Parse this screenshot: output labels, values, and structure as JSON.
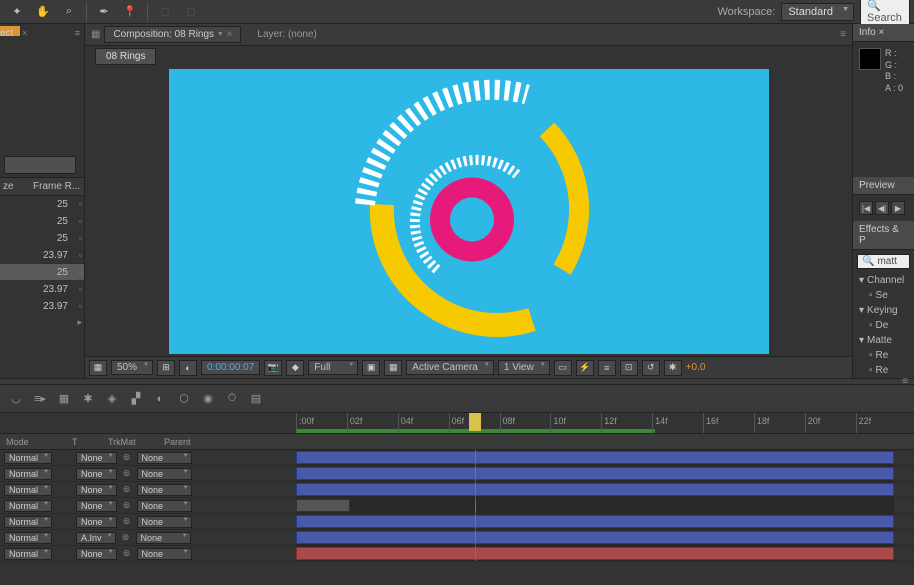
{
  "topbar": {
    "workspace_label": "Workspace:",
    "workspace_value": "Standard",
    "search_placeholder": "Search"
  },
  "left_panel": {
    "headers": [
      "ze",
      "Frame R..."
    ],
    "rows": [
      "25",
      "25",
      "25",
      "23.97",
      "25",
      "23.97",
      "23.97"
    ],
    "highlight_row": 4
  },
  "comp_panel": {
    "tab_label": "Composition: 08 Rings",
    "layer_label": "Layer: (none)",
    "sub_tab": "08 Rings"
  },
  "viewer_controls": {
    "zoom": "50%",
    "timecode": "0:00:00:07",
    "resolution": "Full",
    "camera": "Active Camera",
    "view": "1 View",
    "exposure": "+0.0"
  },
  "info_panel": {
    "title": "Info",
    "r": "R :",
    "g": "G :",
    "b": "B :",
    "a": "A : 0"
  },
  "preview_panel": {
    "title": "Preview"
  },
  "effects_panel": {
    "title": "Effects & P",
    "search": "matt",
    "cats": [
      "Channel",
      "Keying",
      "Matte"
    ],
    "items": [
      "Se",
      "De",
      "Re",
      "Re"
    ]
  },
  "timeline": {
    "head": {
      "mode": "Mode",
      "t": "T",
      "trkmat": "TrkMat",
      "parent": "Parent"
    },
    "ticks": [
      ":00f",
      "02f",
      "04f",
      "06f",
      "08f",
      "10f",
      "12f",
      "14f",
      "16f",
      "18f",
      "20f",
      "22f"
    ],
    "rows": [
      {
        "mode": "Normal",
        "trk": "None",
        "parent": "None",
        "bar": {
          "l": 0,
          "r": 100,
          "c": "b"
        }
      },
      {
        "mode": "Normal",
        "trk": "None",
        "parent": "None",
        "bar": {
          "l": 0,
          "r": 100,
          "c": "b"
        }
      },
      {
        "mode": "Normal",
        "trk": "None",
        "parent": "None",
        "bar": {
          "l": 0,
          "r": 100,
          "c": "b"
        }
      },
      {
        "mode": "Normal",
        "trk": "None",
        "parent": "None",
        "bar": {
          "l": 0,
          "r": 9,
          "c": "t"
        }
      },
      {
        "mode": "Normal",
        "trk": "None",
        "parent": "None",
        "bar": {
          "l": 0,
          "r": 100,
          "c": "b"
        }
      },
      {
        "mode": "Normal",
        "trk": "A.Inv",
        "parent": "None",
        "bar": {
          "l": 0,
          "r": 100,
          "c": "b"
        }
      },
      {
        "mode": "Normal",
        "trk": "None",
        "parent": "None",
        "bar": {
          "l": 0,
          "r": 100,
          "c": "r"
        }
      }
    ],
    "playhead_pct": 30,
    "workbar_pct": 60
  }
}
